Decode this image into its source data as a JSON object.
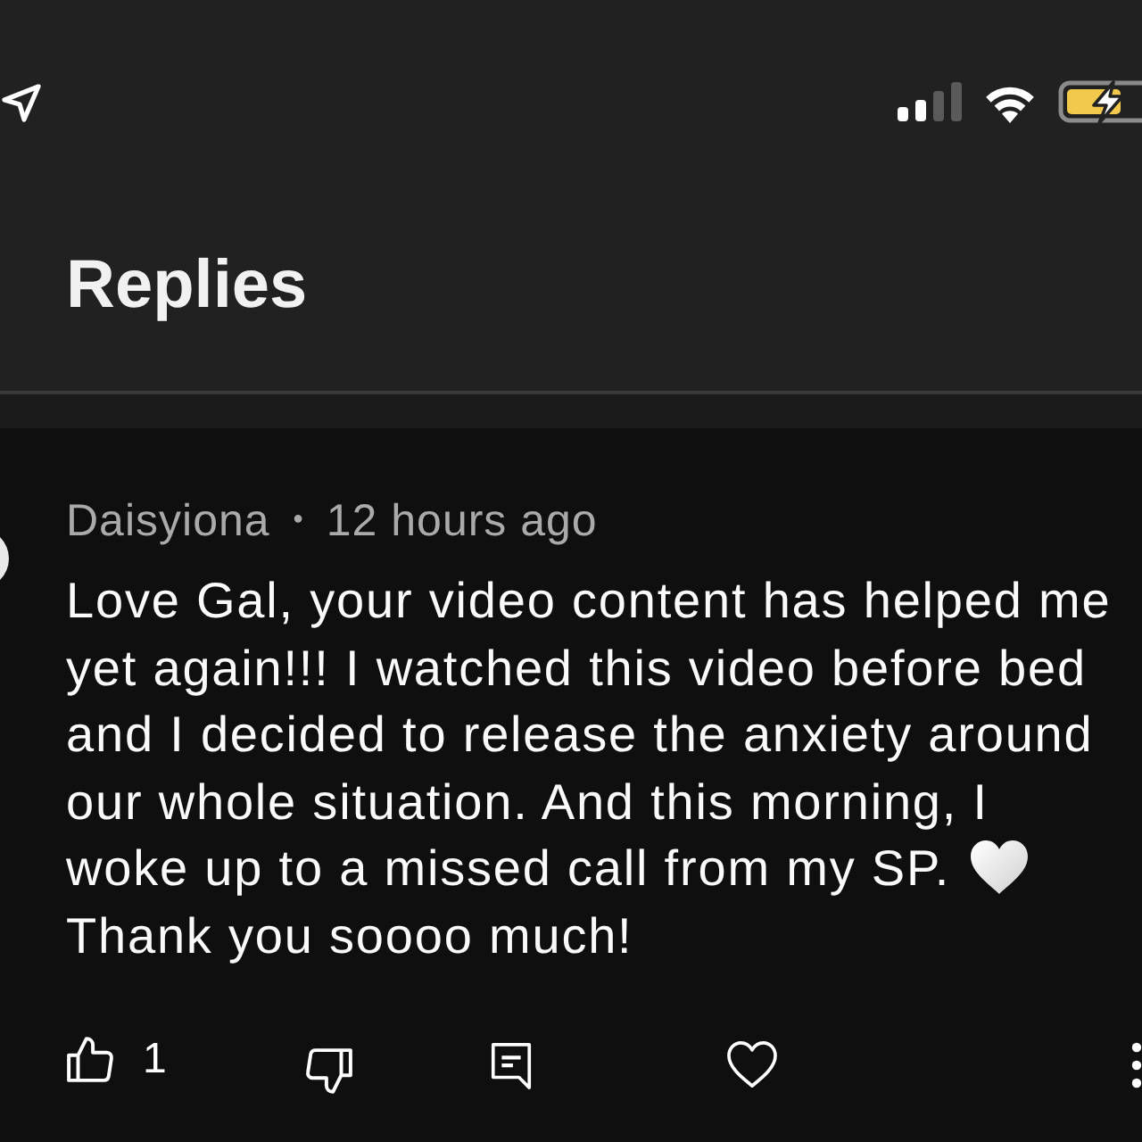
{
  "header": {
    "title": "Replies"
  },
  "comment": {
    "author": "Daisyiona",
    "separator": "•",
    "time": "12 hours ago",
    "body_lines": [
      "Love Gal, your video content has helped me",
      "yet again!!! I watched this video before bed",
      "and I decided to release the anxiety around",
      "our whole situation. And this morning, I",
      "woke up to a missed call from my SP."
    ],
    "closing": "Thank you soooo much!",
    "like_count": "1"
  }
}
